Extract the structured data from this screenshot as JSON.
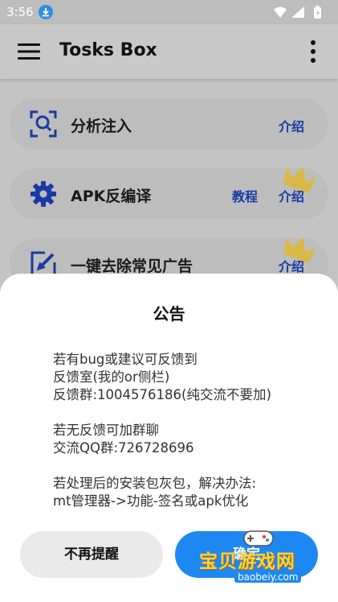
{
  "status_bar": {
    "time": "3:56"
  },
  "app_bar": {
    "title": "Tosks Box"
  },
  "cards": [
    {
      "label": "分析注入",
      "links": [
        "介绍"
      ]
    },
    {
      "label": "APK反编译",
      "links": [
        "教程",
        "介绍"
      ]
    },
    {
      "label": "一键去除常见广告",
      "links": [
        "介绍"
      ]
    }
  ],
  "dialog": {
    "title": "公告",
    "lines": [
      "若有bug或建议可反馈到",
      "反馈室(我的or侧栏)",
      "反馈群:1004576186(纯交流不要加)",
      "若无反馈可加群聊",
      "交流QQ群:726728696",
      "若处理后的安装包灰包，解决办法:",
      "mt管理器->功能-签名或apk优化"
    ],
    "dismiss_label": "不再提醒",
    "ok_label": "确定"
  },
  "watermark": {
    "text": "宝贝游戏网",
    "url": "baobeiy.com"
  },
  "colors": {
    "accent": "#1e88f2",
    "link": "#1a3aa3",
    "icon": "#1a3aa3",
    "crown": "#d9b84a"
  }
}
